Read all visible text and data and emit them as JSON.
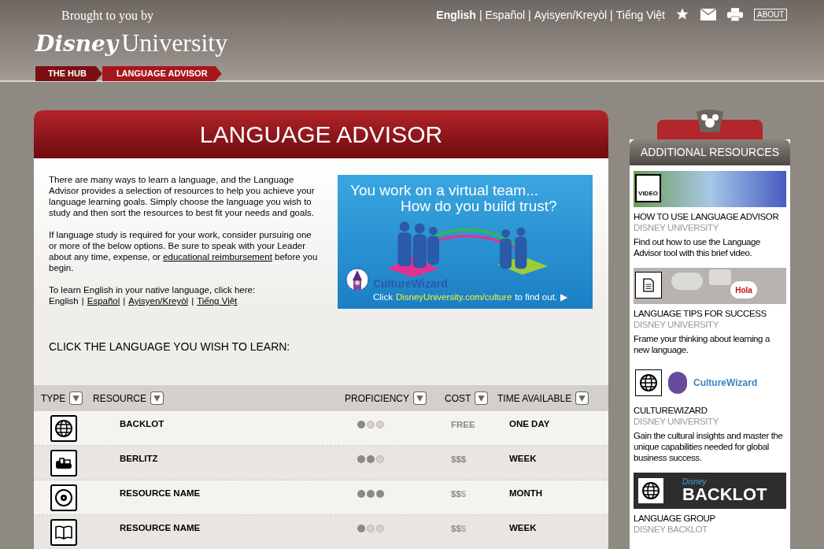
{
  "header": {
    "tagline": "Brought to you by",
    "logo": {
      "brand": "Disney",
      "name": "University"
    },
    "languages": [
      {
        "label": "English",
        "selected": true
      },
      {
        "label": "Español",
        "selected": false
      },
      {
        "label": "Ayisyen/Kreyòl",
        "selected": false
      },
      {
        "label": "Tiếng Việt",
        "selected": false
      }
    ],
    "separator": "|",
    "about": "ABOUT"
  },
  "breadcrumbs": [
    "THE HUB",
    "LANGUAGE ADVISOR"
  ],
  "main": {
    "title": "LANGUAGE ADVISOR",
    "intro": [
      "There are many ways to learn a language, and the Language Advisor provides a selection of resources to help you achieve your language learning goals. Simply choose the language you wish to study and then sort the resources to best fit your needs and goals.",
      "If language study is required for your work, consider pursuing one or more of the below options. Be sure to speak with your Leader about any time, expense, or "
    ],
    "intro_link": "educational reimbursement",
    "intro_tail": " before you begin.",
    "native_prompt": "To learn English in your native language, click here:",
    "native_separator": "|",
    "native_links": [
      {
        "label": "English",
        "link": false
      },
      {
        "label": "Español",
        "link": true
      },
      {
        "label": "Ayisyen/Kreyòl",
        "link": true
      },
      {
        "label": "Tiếng Việt",
        "link": true
      }
    ],
    "banner": {
      "line1": "You work on a virtual team...",
      "line2": "How do you build trust?",
      "brand": "CultureWizard",
      "cta_start": "Click",
      "cta_link": "DisneyUniversity.com/culture",
      "cta_end": "to find out.",
      "arrow": "▶"
    },
    "prompt": "CLICK THE LANGUAGE YOU WISH TO LEARN:"
  },
  "table": {
    "columns": [
      "TYPE",
      "RESOURCE",
      "PROFICIENCY",
      "COST",
      "TIME AVAILABLE"
    ],
    "rows": [
      {
        "kind": "web",
        "resource": "BACKLOT",
        "stars": 1,
        "cost": "FREE",
        "cost_faint": "",
        "time": "ONE DAY"
      },
      {
        "kind": "audio",
        "resource": "BERLITZ",
        "stars": 2,
        "cost": "$$$",
        "cost_faint": "",
        "time": "WEEK"
      },
      {
        "kind": "disc",
        "resource": "RESOURCE NAME",
        "stars": 3,
        "cost": "$$",
        "cost_faint": "$",
        "time": "MONTH"
      },
      {
        "kind": "book",
        "resource": "RESOURCE NAME",
        "stars": 1,
        "cost": "$$",
        "cost_faint": "$",
        "time": "WEEK"
      }
    ]
  },
  "sidebar": {
    "title": "ADDITIONAL RESOURCES",
    "items": [
      {
        "kind": "video",
        "badge": "VIDEO",
        "title": "HOW TO USE LANGUAGE ADVISOR",
        "source": "DISNEY UNIVERSITY",
        "description": "Find out how to use the Language Advisor tool with this brief video."
      },
      {
        "kind": "document",
        "bubble": "Hola",
        "title": "LANGUAGE TIPS FOR SUCCESS",
        "source": "DISNEY UNIVERSITY",
        "description": "Frame your thinking about learning a new language."
      },
      {
        "kind": "web",
        "logo": "CultureWizard",
        "title": "CULTUREWIZARD",
        "source": "DISNEY UNIVERSITY",
        "description": "Gain the cultural insights and master the unique capabilities needed for global business success."
      },
      {
        "kind": "web_dark",
        "logo_small": "Disney",
        "logo": "BACKLOT",
        "title": "LANGUAGE GROUP",
        "source": "DISNEY BACKLOT"
      }
    ]
  }
}
